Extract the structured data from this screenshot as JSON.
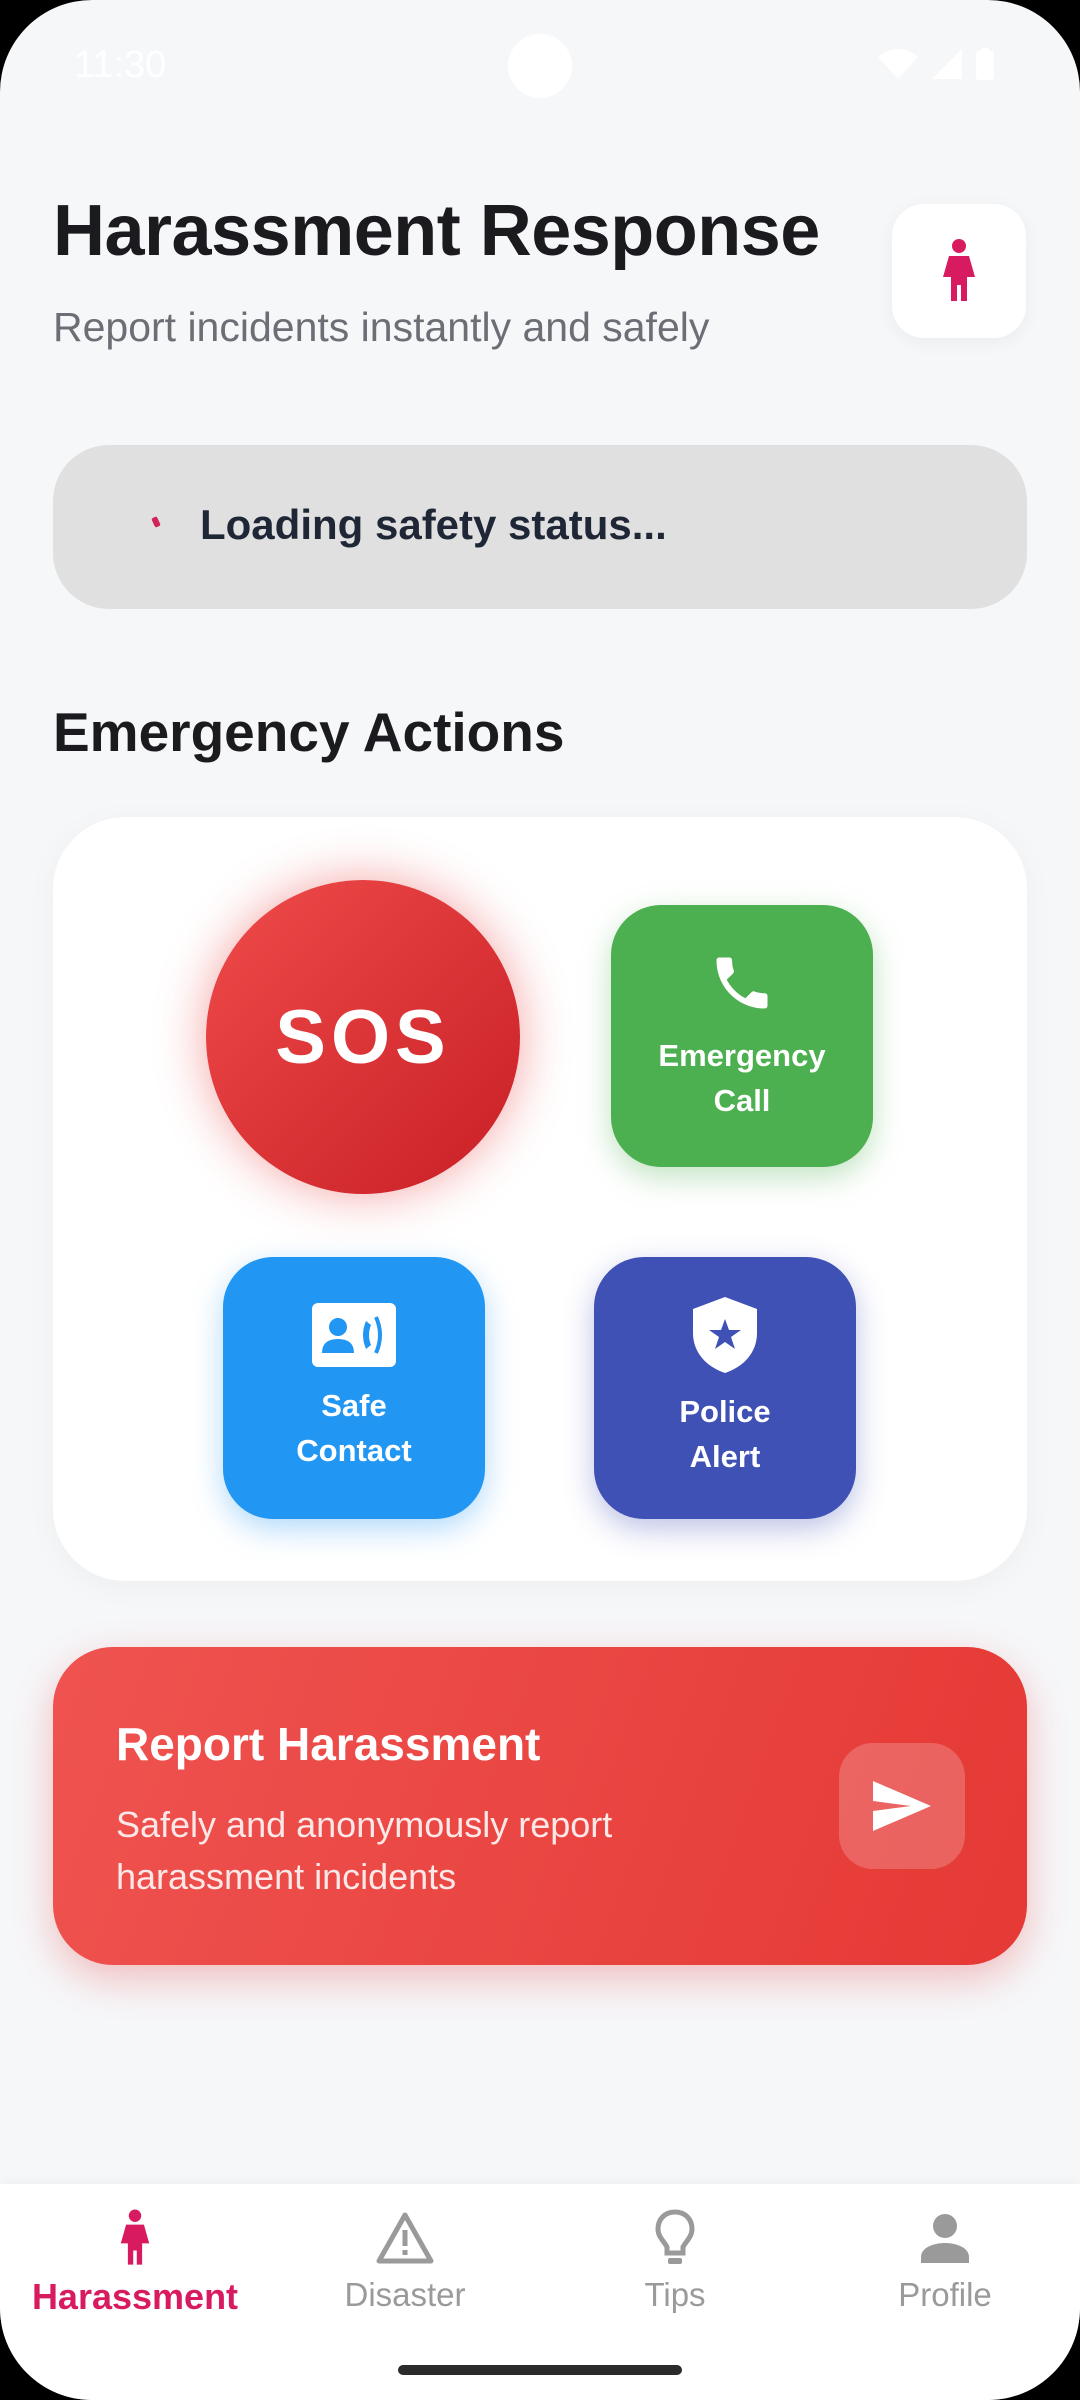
{
  "status_bar": {
    "time": "11:30"
  },
  "header": {
    "title": "Harassment Response",
    "subtitle": "Report incidents instantly and safely",
    "icon": "woman-icon"
  },
  "safety_status": {
    "text": "Loading safety status..."
  },
  "emergency": {
    "section_title": "Emergency Actions",
    "sos_label": "SOS",
    "emergency_call_label": "Emergency\nCall",
    "safe_contact_label": "Safe\nContact",
    "police_alert_label": "Police\nAlert"
  },
  "report": {
    "title": "Report Harassment",
    "description": "Safely and anonymously report harassment incidents"
  },
  "nav": {
    "items": [
      {
        "label": "Harassment",
        "icon": "woman-icon",
        "active": true
      },
      {
        "label": "Disaster",
        "icon": "warning-icon",
        "active": false
      },
      {
        "label": "Tips",
        "icon": "lightbulb-icon",
        "active": false
      },
      {
        "label": "Profile",
        "icon": "person-icon",
        "active": false
      }
    ]
  },
  "colors": {
    "accent": "#d81b60",
    "sos": "#e53935",
    "emergency_call": "#4caf50",
    "safe_contact": "#2196f3",
    "police_alert": "#3f51b5",
    "report": "#ef5350"
  }
}
